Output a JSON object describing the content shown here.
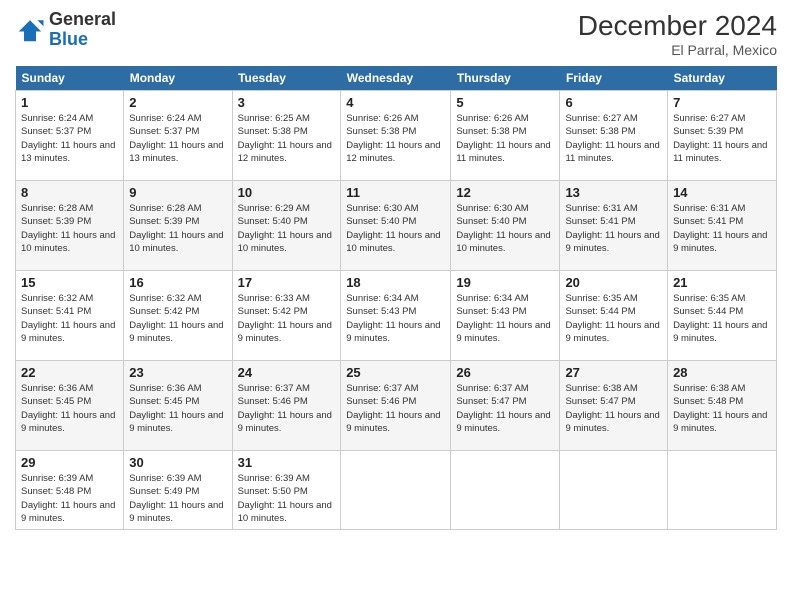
{
  "header": {
    "logo_general": "General",
    "logo_blue": "Blue",
    "month_year": "December 2024",
    "location": "El Parral, Mexico"
  },
  "calendar": {
    "days_of_week": [
      "Sunday",
      "Monday",
      "Tuesday",
      "Wednesday",
      "Thursday",
      "Friday",
      "Saturday"
    ],
    "weeks": [
      [
        {
          "day": "1",
          "sunrise": "6:24 AM",
          "sunset": "5:37 PM",
          "daylight": "11 hours and 13 minutes."
        },
        {
          "day": "2",
          "sunrise": "6:24 AM",
          "sunset": "5:37 PM",
          "daylight": "11 hours and 13 minutes."
        },
        {
          "day": "3",
          "sunrise": "6:25 AM",
          "sunset": "5:38 PM",
          "daylight": "11 hours and 12 minutes."
        },
        {
          "day": "4",
          "sunrise": "6:26 AM",
          "sunset": "5:38 PM",
          "daylight": "11 hours and 12 minutes."
        },
        {
          "day": "5",
          "sunrise": "6:26 AM",
          "sunset": "5:38 PM",
          "daylight": "11 hours and 11 minutes."
        },
        {
          "day": "6",
          "sunrise": "6:27 AM",
          "sunset": "5:38 PM",
          "daylight": "11 hours and 11 minutes."
        },
        {
          "day": "7",
          "sunrise": "6:27 AM",
          "sunset": "5:39 PM",
          "daylight": "11 hours and 11 minutes."
        }
      ],
      [
        {
          "day": "8",
          "sunrise": "6:28 AM",
          "sunset": "5:39 PM",
          "daylight": "11 hours and 10 minutes."
        },
        {
          "day": "9",
          "sunrise": "6:28 AM",
          "sunset": "5:39 PM",
          "daylight": "11 hours and 10 minutes."
        },
        {
          "day": "10",
          "sunrise": "6:29 AM",
          "sunset": "5:40 PM",
          "daylight": "11 hours and 10 minutes."
        },
        {
          "day": "11",
          "sunrise": "6:30 AM",
          "sunset": "5:40 PM",
          "daylight": "11 hours and 10 minutes."
        },
        {
          "day": "12",
          "sunrise": "6:30 AM",
          "sunset": "5:40 PM",
          "daylight": "11 hours and 10 minutes."
        },
        {
          "day": "13",
          "sunrise": "6:31 AM",
          "sunset": "5:41 PM",
          "daylight": "11 hours and 9 minutes."
        },
        {
          "day": "14",
          "sunrise": "6:31 AM",
          "sunset": "5:41 PM",
          "daylight": "11 hours and 9 minutes."
        }
      ],
      [
        {
          "day": "15",
          "sunrise": "6:32 AM",
          "sunset": "5:41 PM",
          "daylight": "11 hours and 9 minutes."
        },
        {
          "day": "16",
          "sunrise": "6:32 AM",
          "sunset": "5:42 PM",
          "daylight": "11 hours and 9 minutes."
        },
        {
          "day": "17",
          "sunrise": "6:33 AM",
          "sunset": "5:42 PM",
          "daylight": "11 hours and 9 minutes."
        },
        {
          "day": "18",
          "sunrise": "6:34 AM",
          "sunset": "5:43 PM",
          "daylight": "11 hours and 9 minutes."
        },
        {
          "day": "19",
          "sunrise": "6:34 AM",
          "sunset": "5:43 PM",
          "daylight": "11 hours and 9 minutes."
        },
        {
          "day": "20",
          "sunrise": "6:35 AM",
          "sunset": "5:44 PM",
          "daylight": "11 hours and 9 minutes."
        },
        {
          "day": "21",
          "sunrise": "6:35 AM",
          "sunset": "5:44 PM",
          "daylight": "11 hours and 9 minutes."
        }
      ],
      [
        {
          "day": "22",
          "sunrise": "6:36 AM",
          "sunset": "5:45 PM",
          "daylight": "11 hours and 9 minutes."
        },
        {
          "day": "23",
          "sunrise": "6:36 AM",
          "sunset": "5:45 PM",
          "daylight": "11 hours and 9 minutes."
        },
        {
          "day": "24",
          "sunrise": "6:37 AM",
          "sunset": "5:46 PM",
          "daylight": "11 hours and 9 minutes."
        },
        {
          "day": "25",
          "sunrise": "6:37 AM",
          "sunset": "5:46 PM",
          "daylight": "11 hours and 9 minutes."
        },
        {
          "day": "26",
          "sunrise": "6:37 AM",
          "sunset": "5:47 PM",
          "daylight": "11 hours and 9 minutes."
        },
        {
          "day": "27",
          "sunrise": "6:38 AM",
          "sunset": "5:47 PM",
          "daylight": "11 hours and 9 minutes."
        },
        {
          "day": "28",
          "sunrise": "6:38 AM",
          "sunset": "5:48 PM",
          "daylight": "11 hours and 9 minutes."
        }
      ],
      [
        {
          "day": "29",
          "sunrise": "6:39 AM",
          "sunset": "5:48 PM",
          "daylight": "11 hours and 9 minutes."
        },
        {
          "day": "30",
          "sunrise": "6:39 AM",
          "sunset": "5:49 PM",
          "daylight": "11 hours and 9 minutes."
        },
        {
          "day": "31",
          "sunrise": "6:39 AM",
          "sunset": "5:50 PM",
          "daylight": "11 hours and 10 minutes."
        },
        null,
        null,
        null,
        null
      ]
    ]
  }
}
